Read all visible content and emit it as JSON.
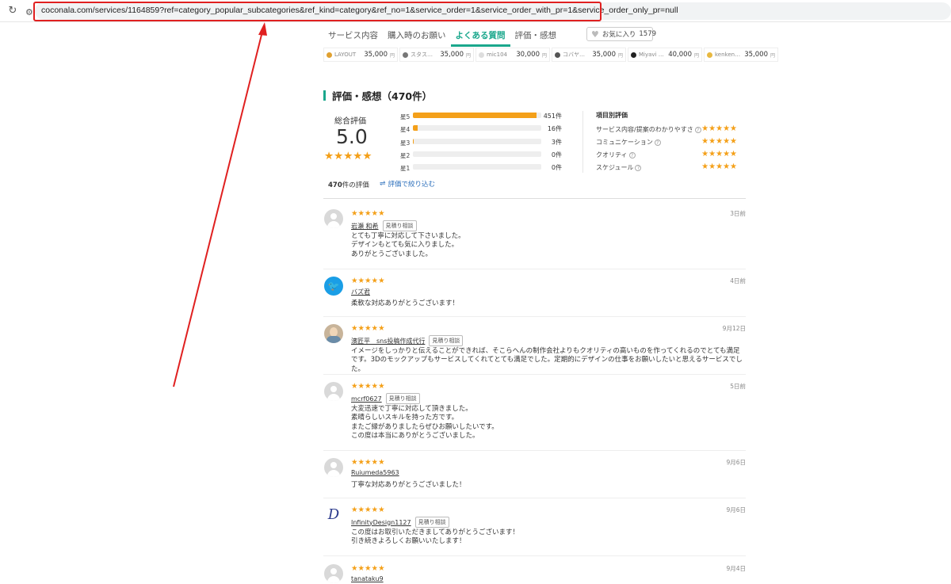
{
  "browser": {
    "url": "coconala.com/services/1164859?ref=category_popular_subcategories&ref_kind=category&ref_no=1&service_order=1&service_order_with_pr=1&service_order_only_pr=null"
  },
  "tabs": [
    {
      "label": "サービス内容"
    },
    {
      "label": "購入時のお願い"
    },
    {
      "label": "よくある質問"
    },
    {
      "label": "評価・感想"
    }
  ],
  "favorite": {
    "label": "お気に入り",
    "count": "1579"
  },
  "related": [
    {
      "name": "LAYOUT",
      "price": "35,000",
      "yen": "円"
    },
    {
      "name": "スタスタス···",
      "price": "35,000",
      "yen": "円"
    },
    {
      "name": "mic104",
      "price": "30,000",
      "yen": "円"
    },
    {
      "name": "コバヤシ···",
      "price": "35,000",
      "yen": "円"
    },
    {
      "name": "Miyavi Desi···",
      "price": "40,000",
      "yen": "円"
    },
    {
      "name": "kenken des···",
      "price": "35,000",
      "yen": "円"
    }
  ],
  "summary": {
    "title": "評価・感想（470件）",
    "overall_label": "総合評価",
    "score": "5.0",
    "stars": "★★★★★",
    "distribution": [
      {
        "label": "星5",
        "count": "451件",
        "fraction": 0.96
      },
      {
        "label": "星4",
        "count": "16件",
        "fraction": 0.034
      },
      {
        "label": "星3",
        "count": "3件",
        "fraction": 0.008
      },
      {
        "label": "星2",
        "count": "0件",
        "fraction": 0
      },
      {
        "label": "星1",
        "count": "0件",
        "fraction": 0
      }
    ],
    "items_title": "項目別評価",
    "items": [
      {
        "label": "サービス内容/提案のわかりやすさ",
        "stars": "★★★★★"
      },
      {
        "label": "コミュニケーション",
        "stars": "★★★★★"
      },
      {
        "label": "クオリティ",
        "stars": "★★★★★"
      },
      {
        "label": "スケジュール",
        "stars": "★★★★★"
      }
    ],
    "count_num": "470",
    "count_suffix": "件の評価",
    "filter_label": "評価で絞り込む"
  },
  "reviews": [
    {
      "user": "岩瀬 和希",
      "badge": "見積り相談",
      "date": "3日前",
      "stars": "★★★★★",
      "text": [
        "とても丁寧に対応して下さいました。",
        "デザインもとても気に入りました。",
        "ありがとうございました。"
      ]
    },
    {
      "user": "バズ君",
      "badge": "",
      "date": "4日前",
      "stars": "★★★★★",
      "text": [
        "柔軟な対応ありがとうございます！"
      ]
    },
    {
      "user": "濱匠平　sns投稿作成代行",
      "badge": "見積り相談",
      "date": "9月12日",
      "stars": "★★★★★",
      "text": [
        "イメージをしっかりと伝えることができれば、そこらへんの制作会社よりもクオリティの高いものを作ってくれるのでとても満足です。3Dのモックアップもサービスしてくれてとても満足でした。定期的にデザインの仕事をお願いしたいと思えるサービスでした。"
      ]
    },
    {
      "user": "mcrf0627",
      "badge": "見積り相談",
      "date": "5日前",
      "stars": "★★★★★",
      "text": [
        "大変迅速で丁寧に対応して頂きました。",
        "素晴らしいスキルを持った方です。",
        "またご縁がありましたらぜひお願いしたいです。",
        "この度は本当にありがとうございました。"
      ]
    },
    {
      "user": "Ruiumeda5963",
      "badge": "",
      "date": "9月6日",
      "stars": "★★★★★",
      "text": [
        "丁寧な対応ありがとうございました！"
      ]
    },
    {
      "user": "InfinityDesign1127",
      "badge": "見積り相談",
      "date": "9月6日",
      "stars": "★★★★★",
      "text": [
        "この度はお取引いただきましてありがとうございます！",
        "引き続きよろしくお願いいたします！"
      ]
    },
    {
      "user": "tanataku9",
      "badge": "",
      "date": "9月4日",
      "stars": "★★★★★",
      "text": []
    }
  ],
  "colors": {
    "accent": "#1aa78c",
    "star": "#f4a019",
    "annotation": "#e02020"
  }
}
